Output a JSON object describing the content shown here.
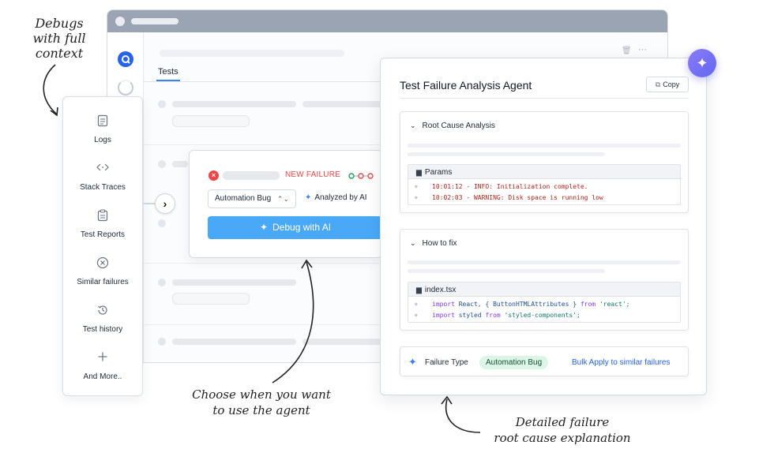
{
  "background_window": {
    "tab": "Tests"
  },
  "left_menu": {
    "items": [
      {
        "label": "Logs",
        "icon": "document-icon"
      },
      {
        "label": "Stack Traces",
        "icon": "code-icon"
      },
      {
        "label": "Test Reports",
        "icon": "clipboard-icon"
      },
      {
        "label": "Similar failures",
        "icon": "circle-x-icon"
      },
      {
        "label": "Test history",
        "icon": "history-icon"
      },
      {
        "label": "And More..",
        "icon": "plus-icon"
      }
    ]
  },
  "failure_card": {
    "status": "NEW FAILURE",
    "category": "Automation Bug",
    "analyzed": "Analyzed by AI",
    "debug_button": "Debug with AI"
  },
  "agent_panel": {
    "title": "Test Failure Analysis Agent",
    "copy_label": "Copy",
    "root_cause": {
      "heading": "Root Cause Analysis",
      "file": "Params",
      "lines": [
        "10:01:12 - INFO: Initialization complete.",
        "10:02:03 - WARNING: Disk space is running low"
      ]
    },
    "how_to_fix": {
      "heading": "How to fix",
      "file": "index.tsx",
      "line1": {
        "kw": "import",
        "rest": " React, { ButtonHTMLAttributes } ",
        "from": "from",
        "str": " 'react';"
      },
      "line2": {
        "kw": "import",
        "rest": " styled ",
        "from": "from",
        "str": " 'styled-components';"
      }
    },
    "failure_type": {
      "label": "Failure Type",
      "badge": "Automation Bug",
      "bulk_apply": "Bulk Apply  to similar failures"
    }
  },
  "annotations": {
    "top_left": [
      "Debugs",
      "with full",
      "context"
    ],
    "bottom_middle": [
      "Choose when you want",
      "to use the agent"
    ],
    "bottom_right": [
      "Detailed failure",
      "root cause explanation"
    ]
  },
  "colors": {
    "accent": "#4aa9f7",
    "failure": "#ef4444",
    "badge_bg": "#dcf5e7",
    "link": "#2563eb",
    "ai_purple": "#6366f1"
  }
}
